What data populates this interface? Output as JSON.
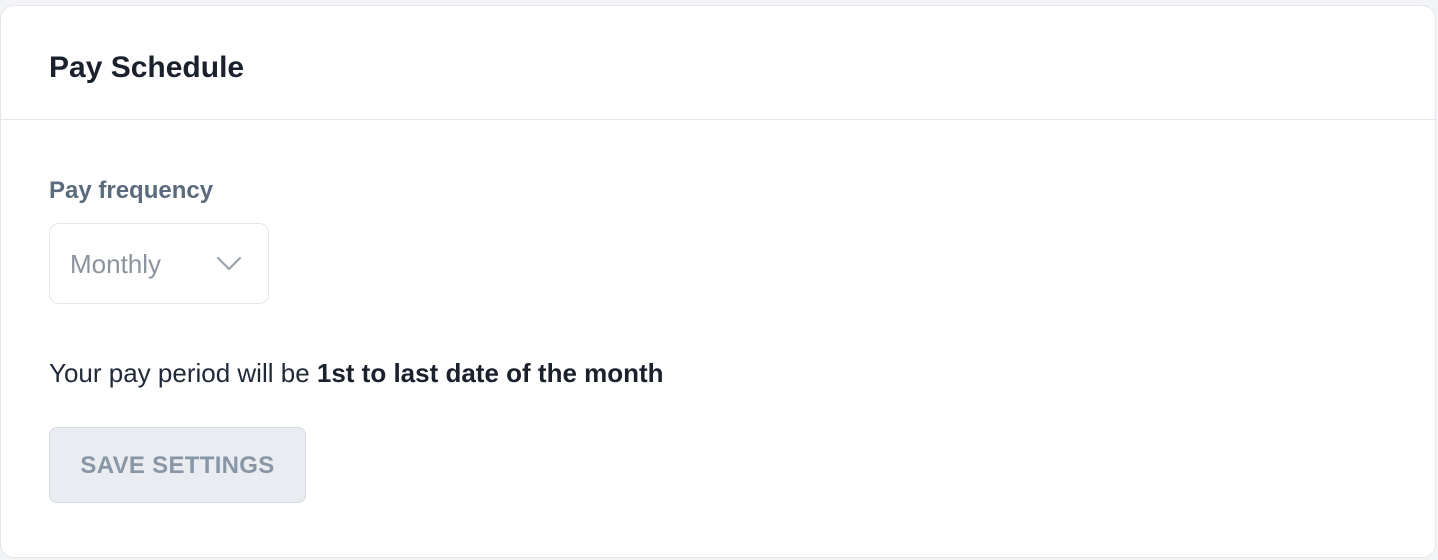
{
  "card": {
    "title": "Pay Schedule"
  },
  "pay_frequency": {
    "label": "Pay frequency",
    "selected": "Monthly",
    "icon": "chevron-down-icon"
  },
  "pay_period": {
    "prefix": "Your pay period will be ",
    "highlight": "1st to last date of the month"
  },
  "actions": {
    "save_label": "SAVE SETTINGS"
  }
}
